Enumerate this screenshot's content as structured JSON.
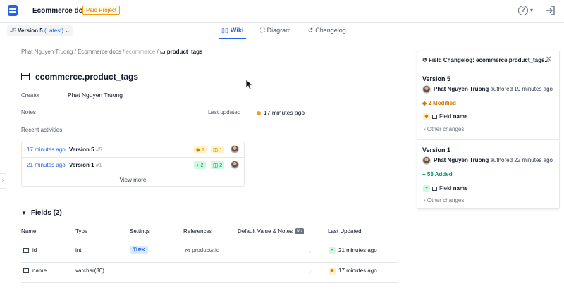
{
  "header": {
    "project_title": "Ecommerce docs",
    "badge": "Paid Project",
    "help_icon": "help-circle-icon",
    "help_caret": "▾",
    "exit_icon": "sign-in-icon"
  },
  "subbar": {
    "version_number": "#5",
    "version_name": "Version 5",
    "version_tag": "(Latest)",
    "version_caret": "⌄",
    "tabs": [
      {
        "label": "Wiki",
        "icon": "book-icon",
        "glyph": "📖",
        "active": true
      },
      {
        "label": "Diagram",
        "icon": "diagram-icon",
        "glyph": "⛶",
        "active": false
      },
      {
        "label": "Changelog",
        "icon": "history-icon",
        "glyph": "↺",
        "active": false
      }
    ]
  },
  "breadcrumb": {
    "owner": "Phat Nguyen Truong",
    "project": "Ecommerce docs",
    "schema": "ecommerce",
    "table": "product_tags",
    "sep": " / "
  },
  "table": {
    "title": "ecommerce.product_tags",
    "creator_label": "Creator",
    "creator": "Phat Nguyen Truong",
    "notes_label": "Notes",
    "last_updated_label": "Last updated",
    "last_updated": "17 minutes ago",
    "recent_label": "Recent activities"
  },
  "activities": [
    {
      "time": "17 minutes ago",
      "version": "Version 5",
      "vnum": "#5",
      "chip_a": "◆ 1",
      "chip_b": "◫ 1",
      "kind": "mod"
    },
    {
      "time": "21 minutes ago",
      "version": "Version 1",
      "vnum": "#1",
      "chip_a": "+ 2",
      "chip_b": "◫ 2",
      "kind": "add"
    }
  ],
  "view_more": "View more",
  "fields": {
    "heading": "Fields (2)",
    "columns": [
      "Name",
      "Type",
      "Settings",
      "References",
      "Default Value & Notes",
      "Last Updated"
    ],
    "md_badge": "M↓",
    "rows": [
      {
        "name": "id",
        "type": "int",
        "settings": "PK",
        "reference": "products.id",
        "ref_glyph": "⋈",
        "updated": "21 minutes ago",
        "update_kind": "add",
        "update_glyph": "+"
      },
      {
        "name": "name",
        "type": "varchar(30)",
        "settings": "",
        "reference": "",
        "ref_glyph": "",
        "updated": "17 minutes ago",
        "update_kind": "mod",
        "update_glyph": "◆"
      }
    ]
  },
  "panel": {
    "title": "Field Changelog: ecommerce.product_tags...",
    "close_glyph": "✕",
    "versions": [
      {
        "title": "Version 5",
        "author": "Phat Nguyen Truong",
        "action": "authored 19 minutes ago",
        "summary": "◆ 2 Modified",
        "kind": "mod",
        "field_label": "Field",
        "field_name": "name",
        "chip": "◆",
        "other": "› Other changes"
      },
      {
        "title": "Version 1",
        "author": "Phat Nguyen Truong",
        "action": "authored 22 minutes ago",
        "summary": "+ 53 Added",
        "kind": "add",
        "field_label": "Field",
        "field_name": "name",
        "chip": "+",
        "other": "› Other changes"
      }
    ]
  },
  "left_tab_glyph": "›",
  "colors": {
    "accent": "#2563eb",
    "modified": "#d97706",
    "added": "#059669",
    "badge": "#f59e0b"
  }
}
